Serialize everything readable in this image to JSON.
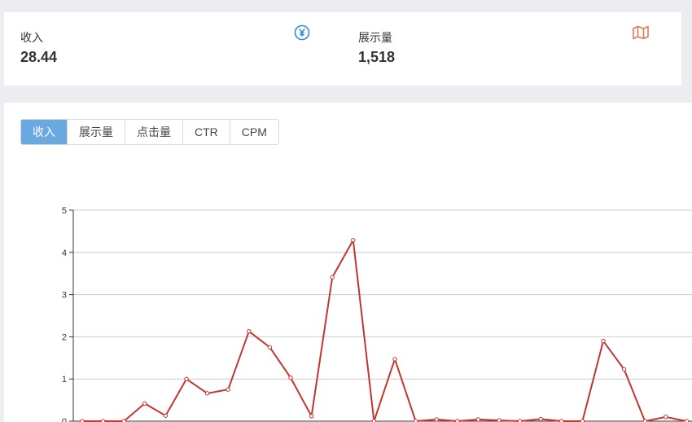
{
  "stats": [
    {
      "label": "收入",
      "value": "28.44",
      "icon": "yen-icon",
      "icon_color": "#2e8fd6"
    },
    {
      "label": "展示量",
      "value": "1,518",
      "icon": "map-icon",
      "icon_color": "#e07a52"
    }
  ],
  "tabs": [
    {
      "label": "收入",
      "active": true
    },
    {
      "label": "展示量",
      "active": false
    },
    {
      "label": "点击量",
      "active": false
    },
    {
      "label": "CTR",
      "active": false
    },
    {
      "label": "CPM",
      "active": false
    }
  ],
  "colors": {
    "line": "#c23531",
    "active_tab": "#6aa8e0",
    "grid": "#cccccc"
  },
  "chart_data": {
    "type": "line",
    "ylim": [
      0,
      5
    ],
    "yticks": [
      0,
      1,
      2,
      3,
      4,
      5
    ],
    "series": [
      {
        "values": [
          0,
          0,
          0,
          0.42,
          0.13,
          1.0,
          0.66,
          0.75,
          2.13,
          1.75,
          1.03,
          0.12,
          3.41,
          4.29,
          0,
          1.47,
          0,
          0.04,
          0,
          0.04,
          0.02,
          0,
          0.05,
          0,
          0,
          1.9,
          1.23,
          0,
          0.1,
          0
        ]
      }
    ]
  }
}
